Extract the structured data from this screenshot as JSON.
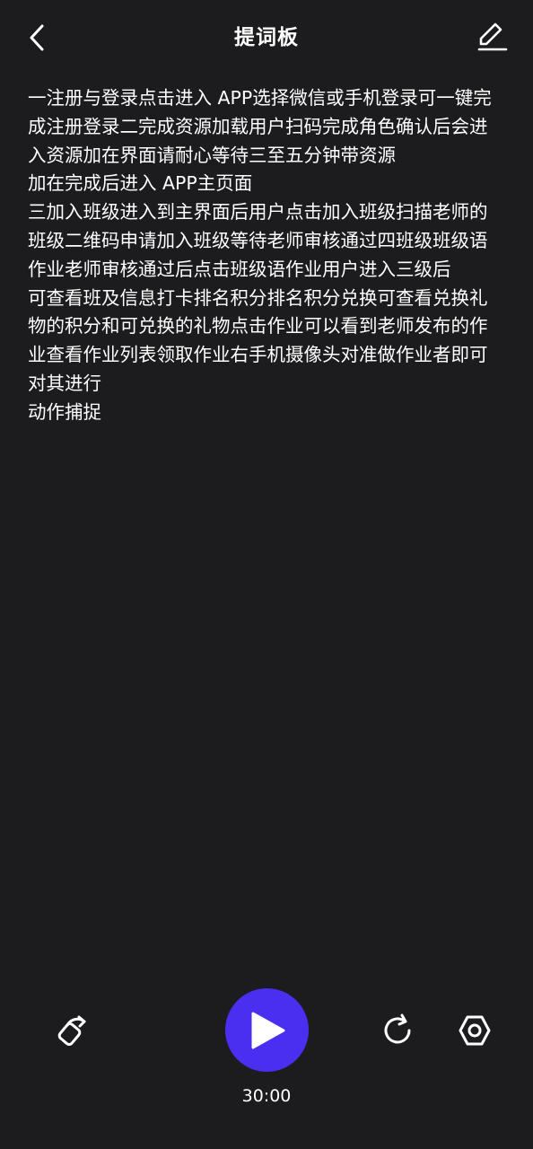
{
  "header": {
    "title": "提词板",
    "back_icon": "chevron-left-icon",
    "edit_icon": "edit-pencil-icon"
  },
  "script": {
    "lines": [
      "一注册与登录点击进入 APP选择微信或手机登录可一键完",
      "成注册登录二完成资源加载用户扫码完成角色确认后会进",
      "入资源加在界面请耐心等待三至五分钟带资源",
      "加在完成后进入 APP主页面",
      "三加入班级进入到主界面后用户点击加入班级扫描老师的",
      "班级二维码申请加入班级等待老师审核通过四班级班级语",
      "作业老师审核通过后点击班级语作业用户进入三级后",
      "可查看班及信息打卡排名积分排名积分兑换可查看兑换礼",
      "物的积分和可兑换的礼物点击作业可以看到老师发布的作",
      "业查看作业列表领取作业右手机摄像头对准做作业者即可",
      "对其进行",
      "动作捕捉"
    ]
  },
  "controls": {
    "mirror_icon": "mirror-flip-icon",
    "play_icon": "play-icon",
    "reset_icon": "refresh-icon",
    "settings_icon": "settings-hexagon-icon",
    "timer": "30:00"
  },
  "colors": {
    "background": "#1c1c1f",
    "accent": "#4a2ff0",
    "text": "#ffffff"
  }
}
